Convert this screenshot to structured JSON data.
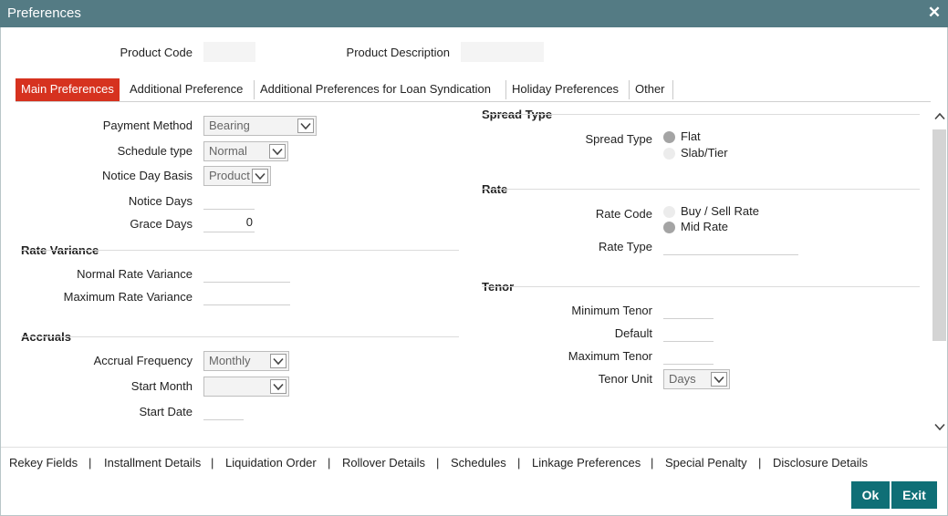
{
  "window": {
    "title": "Preferences",
    "close_symbol": "✕"
  },
  "header": {
    "product_code_label": "Product Code",
    "product_code_value": "",
    "product_description_label": "Product Description",
    "product_description_value": ""
  },
  "tabs": [
    {
      "label": "Main Preferences",
      "active": true
    },
    {
      "label": "Additional Preference",
      "active": false
    },
    {
      "label": "Additional Preferences for Loan Syndication",
      "active": false
    },
    {
      "label": "Holiday Preferences",
      "active": false
    },
    {
      "label": "Other",
      "active": false
    }
  ],
  "left": {
    "payment_method": {
      "label": "Payment Method",
      "value": "Bearing"
    },
    "schedule_type": {
      "label": "Schedule type",
      "value": "Normal"
    },
    "notice_day_basis": {
      "label": "Notice Day Basis",
      "value": "Product"
    },
    "notice_days": {
      "label": "Notice Days",
      "value": ""
    },
    "grace_days": {
      "label": "Grace Days",
      "value": "0"
    },
    "rate_variance": {
      "title": "Rate Variance",
      "normal_label": "Normal Rate Variance",
      "normal_value": "",
      "maximum_label": "Maximum Rate Variance",
      "maximum_value": ""
    },
    "accruals": {
      "title": "Accruals",
      "frequency_label": "Accrual Frequency",
      "frequency_value": "Monthly",
      "start_month_label": "Start Month",
      "start_month_value": "",
      "start_date_label": "Start Date",
      "start_date_value": ""
    }
  },
  "right": {
    "spread_type": {
      "title": "Spread Type",
      "label": "Spread Type",
      "options": [
        {
          "label": "Flat",
          "selected": true
        },
        {
          "label": "Slab/Tier",
          "selected": false
        }
      ]
    },
    "rate": {
      "title": "Rate",
      "rate_code_label": "Rate Code",
      "options": [
        {
          "label": "Buy / Sell Rate",
          "selected": false
        },
        {
          "label": "Mid Rate",
          "selected": true
        }
      ],
      "rate_type_label": "Rate Type",
      "rate_type_value": ""
    },
    "tenor": {
      "title": "Tenor",
      "minimum_label": "Minimum Tenor",
      "minimum_value": "",
      "default_label": "Default",
      "default_value": "",
      "maximum_label": "Maximum Tenor",
      "maximum_value": "",
      "unit_label": "Tenor Unit",
      "unit_value": "Days"
    }
  },
  "footer_links": [
    "Rekey Fields",
    "Installment Details",
    "Liquidation Order",
    "Rollover Details",
    "Schedules",
    "Linkage Preferences",
    "Special Penalty",
    "Disclosure Details"
  ],
  "link_separator": "|",
  "buttons": {
    "ok": "Ok",
    "exit": "Exit"
  },
  "colors": {
    "titlebar": "#547b84",
    "active_tab": "#d6321f",
    "button": "#0f6f76"
  }
}
